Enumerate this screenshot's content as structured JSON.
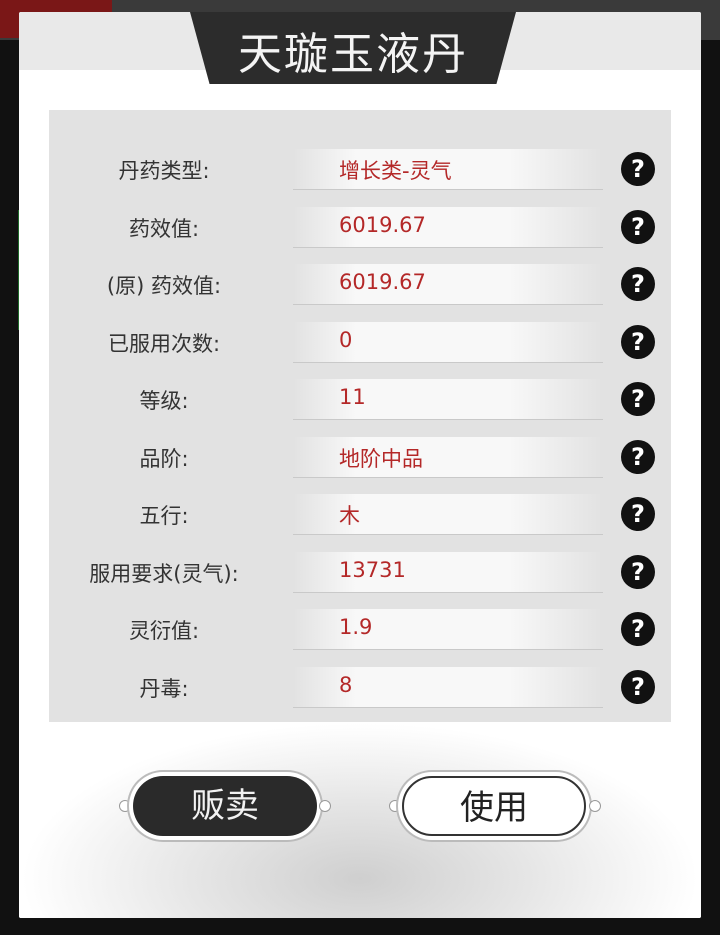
{
  "title": "天璇玉液丹",
  "rows": [
    {
      "label": "丹药类型:",
      "value": "增长类-灵气"
    },
    {
      "label": "药效值:",
      "value": "6019.67"
    },
    {
      "label": "(原) 药效值:",
      "value": "6019.67"
    },
    {
      "label": "已服用次数:",
      "value": "0"
    },
    {
      "label": "等级:",
      "value": "11"
    },
    {
      "label": "品阶:",
      "value": "地阶中品"
    },
    {
      "label": "五行:",
      "value": "木"
    },
    {
      "label": "服用要求(灵气):",
      "value": "13731"
    },
    {
      "label": "灵衍值:",
      "value": "1.9"
    },
    {
      "label": "丹毒:",
      "value": "8"
    }
  ],
  "help_glyph": "?",
  "buttons": {
    "sell": "贩卖",
    "use": "使用"
  },
  "colors": {
    "value_text": "#b42828",
    "panel_bg": "#e2e2e2",
    "plate": "#2c2c2c"
  },
  "icons": {
    "help": "question-mark-icon"
  }
}
